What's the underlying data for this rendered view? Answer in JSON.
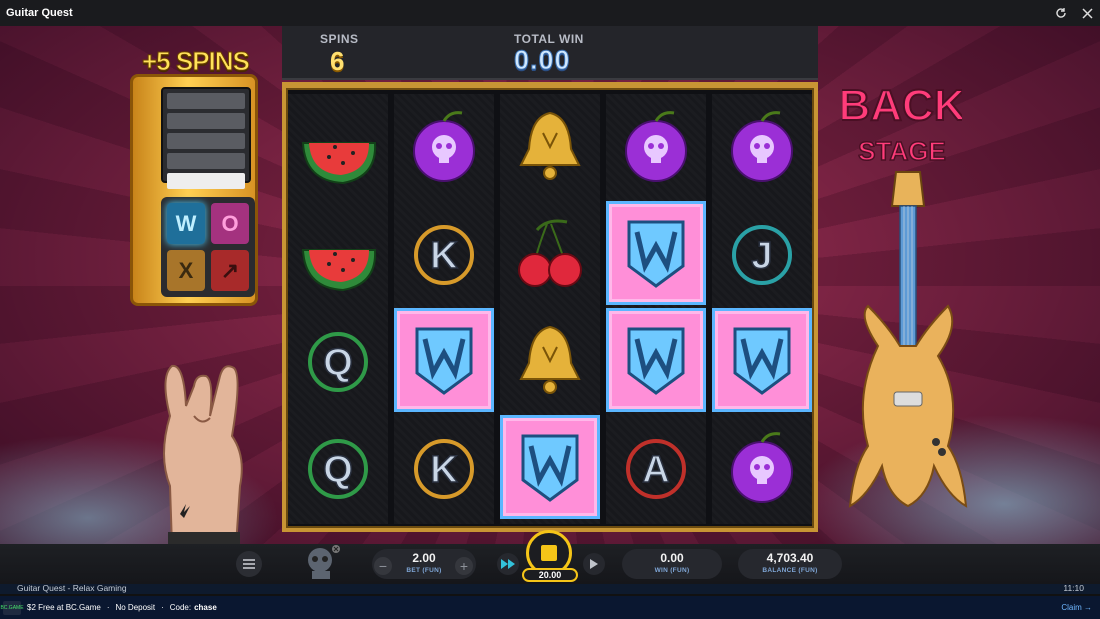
{
  "window": {
    "title": "Guitar Quest"
  },
  "hud": {
    "spins_label": "SPINS",
    "spins_value": "6",
    "total_win_label": "TOTAL WIN",
    "total_win_value": "0.00"
  },
  "booth": {
    "plus_spins": "+5 SPINS",
    "keys": [
      "W",
      "O",
      "X",
      "↗"
    ]
  },
  "logo": {
    "line1": "BACK",
    "line2": "STAGE"
  },
  "reels": [
    [
      "watermelon",
      "watermelon",
      "Q",
      "Q"
    ],
    [
      "plum",
      "K",
      "wild",
      "K"
    ],
    [
      "bell",
      "cherry",
      "bell",
      "wild"
    ],
    [
      "plum",
      "wild",
      "wild",
      "A"
    ],
    [
      "plum",
      "J",
      "wild",
      "plum"
    ]
  ],
  "controls": {
    "bet_value": "2.00",
    "bet_label": "BET (FUN)",
    "spin_cost": "20.00",
    "win_value": "0.00",
    "win_label": "WIN (FUN)",
    "balance_value": "4,703.40",
    "balance_label": "BALANCE (FUN)"
  },
  "info": {
    "game_name": "Guitar Quest - Relax Gaming",
    "time": "11:10"
  },
  "promo": {
    "offer": "$2 Free at BC.Game",
    "deposit": "No Deposit",
    "code_label": "Code:",
    "code": "chase",
    "claim": "Claim →",
    "logo_text": "BC.GAME"
  },
  "colors": {
    "accent": "#f5c518",
    "wild_bg": "#ff8fd8",
    "frame_gold": "#c89534"
  }
}
